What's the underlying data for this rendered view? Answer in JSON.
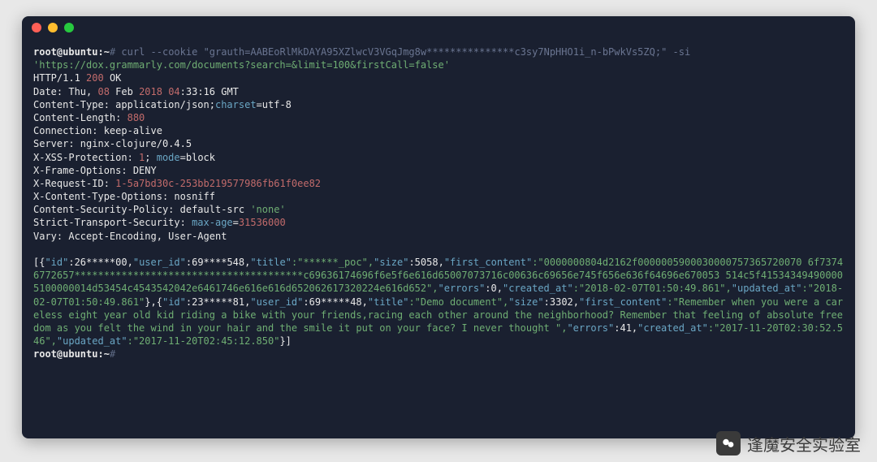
{
  "prompt": {
    "user_host": "root@ubuntu",
    "sep": ":~",
    "hash": "#",
    "cmd_prefix": "curl --cookie ",
    "cookie": "\"grauth=AABEoRlMkDAYA95XZlwcV3VGqJmg8w***************c3sy7NpHHO1i_n-bPwkVs5ZQ;\"",
    "flags": " -si",
    "url": "'https://dox.grammarly.com/documents?search=&limit=100&firstCall=false'"
  },
  "http": {
    "proto": "HTTP/1.1",
    "status_code": "200",
    "status_text": "OK"
  },
  "headers": {
    "date_label": "Date: Thu, ",
    "date_day": "08",
    "date_mid": " Feb ",
    "date_year": "2018",
    "date_time_h": " 04",
    "date_time_rest": ":33:16 GMT",
    "ctype_label": "Content-Type: application/json;",
    "ctype_charset_k": "charset",
    "ctype_charset_v": "=utf-8",
    "clen_label": "Content-Length: ",
    "clen_val": "880",
    "connection": "Connection: keep-alive",
    "server": "Server: nginx-clojure/0.4.5",
    "xss_label": "X-XSS-Protection: ",
    "xss_1": "1",
    "xss_sep": "; ",
    "xss_mode_k": "mode",
    "xss_mode_v": "=block",
    "xframe": "X-Frame-Options: DENY",
    "xreq_label": "X-Request-ID: ",
    "xreq_val": "1-5a7bd30c-253bb219577986fb61f0ee82",
    "xcto": "X-Content-Type-Options: nosniff",
    "csp_label": "Content-Security-Policy: default-src ",
    "csp_val": "'none'",
    "sts_label": "Strict-Transport-Security: ",
    "sts_key": "max-age",
    "sts_eq": "=",
    "sts_val": "31536000",
    "vary": "Vary: Accept-Encoding, User-Agent"
  },
  "json": {
    "open": "[{",
    "id_k": "\"id\"",
    "id_v": ":26*****00,",
    "uid_k": "\"user_id\"",
    "uid_v": ":69****548,",
    "title_k": "\"title\"",
    "title_v": ":\"******_poc\",",
    "size_k": "\"size\"",
    "size_v": ":5058,",
    "fc_k": "\"first_content\"",
    "fc_v": ":\"0000000804d2162f0000005900030000757365720070 6f73746772657***************************************c69636174696f6e5f6e616d65007073716c00636c69656e745f656e636f64696e670053 514c5f415343494900005100000014d53454c4543542042e6461746e616e616d652062617320224e616d652\",",
    "err_k": "\"errors\"",
    "err_v": ":0,",
    "ca_k": "\"created_at\"",
    "ca_v": ":\"2018-02-07T01:50:49.861\",",
    "ua_k": "\"updated_at\"",
    "ua_v": ":\"2018-02-07T01:50:49.861\"",
    "mid": "},{",
    "id2_k": "\"id\"",
    "id2_v": ":23*****81,",
    "uid2_k": "\"user_id\"",
    "uid2_v": ":69*****48,",
    "title2_k": "\"title\"",
    "title2_v": ":\"Demo document\",",
    "size2_k": "\"size\"",
    "size2_v": ":3302,",
    "fc2_k": "\"first_content\"",
    "fc2_v": ":\"Remember when you were a careless eight year old kid riding a bike with your friends,racing each other around the neighborhood? Remember that feeling of absolute freedom as you felt the wind in your hair and the smile it put on your face? I never thought \",",
    "err2_k": "\"errors\"",
    "err2_v": ":41,",
    "ca2_k": "\"created_at\"",
    "ca2_v": ":\"2017-11-20T02:30:52.546\",",
    "ua2_k": "\"updated_at\"",
    "ua2_v": ":\"2017-11-20T02:45:12.850\"",
    "close": "}]"
  },
  "prompt2": {
    "user_host": "root@ubuntu",
    "sep": ":~",
    "hash": "#"
  },
  "watermark": {
    "text": "逢魔安全实验室"
  }
}
